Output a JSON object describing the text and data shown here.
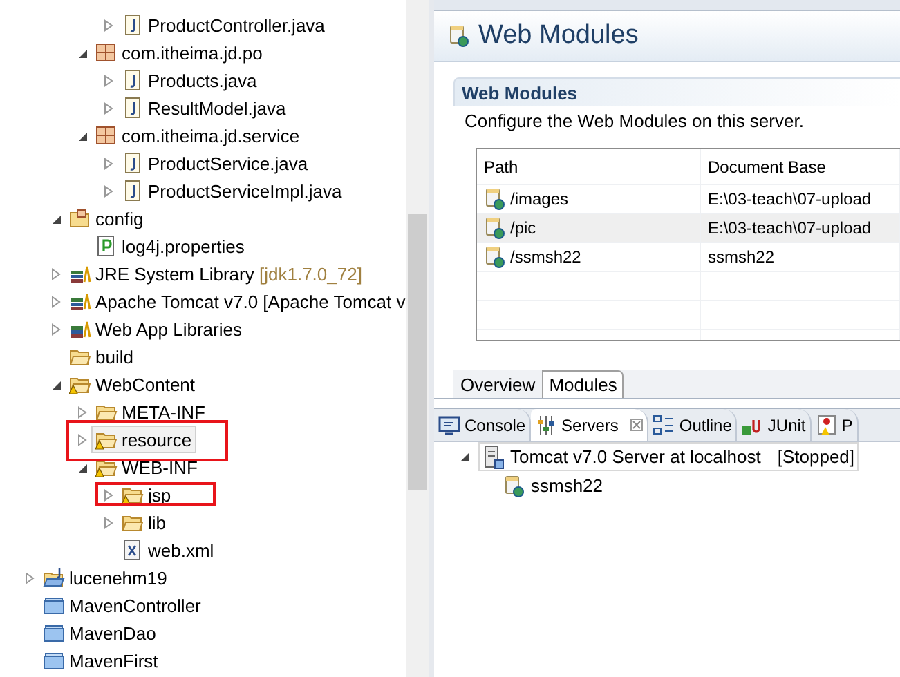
{
  "explorer": {
    "tree": [
      {
        "children": [
          {
            "children": [
              {
                "children": [
                  {
                    "label": "ProductController.java",
                    "kind": "java",
                    "expanded": false
                  }
                ]
              },
              {
                "label": "com.itheima.jd.po",
                "kind": "package",
                "expanded": true,
                "children": [
                  {
                    "label": "Products.java",
                    "kind": "java",
                    "expanded": false
                  },
                  {
                    "label": "ResultModel.java",
                    "kind": "java",
                    "expanded": false
                  }
                ]
              },
              {
                "label": "com.itheima.jd.service",
                "kind": "package",
                "expanded": true,
                "children": [
                  {
                    "label": "ProductService.java",
                    "kind": "java",
                    "expanded": false
                  },
                  {
                    "label": "ProductServiceImpl.java",
                    "kind": "java",
                    "expanded": false
                  }
                ]
              }
            ]
          },
          {
            "label": "config",
            "kind": "source-folder",
            "expanded": true,
            "children": [
              {
                "label": "log4j.properties",
                "kind": "properties"
              }
            ]
          },
          {
            "label": "JRE System Library",
            "decoration": "[jdk1.7.0_72]",
            "kind": "library",
            "expanded": false
          },
          {
            "label": "Apache Tomcat v7.0 [Apache Tomcat v",
            "kind": "library",
            "expanded": false
          },
          {
            "label": "Web App Libraries",
            "kind": "library",
            "expanded": false
          },
          {
            "label": "build",
            "kind": "folder"
          },
          {
            "label": "WebContent",
            "kind": "folder",
            "warning": true,
            "expanded": true,
            "children": [
              {
                "label": "META-INF",
                "kind": "folder",
                "expanded": false
              },
              {
                "label": "resource",
                "kind": "folder",
                "warning": true,
                "expanded": false,
                "selected": true,
                "annotated": true
              },
              {
                "label": "WEB-INF",
                "kind": "folder",
                "warning": true,
                "expanded": true,
                "children": [
                  {
                    "label": "jsp",
                    "kind": "folder",
                    "warning": true,
                    "expanded": false,
                    "annotated": true
                  },
                  {
                    "label": "lib",
                    "kind": "folder",
                    "expanded": false
                  },
                  {
                    "label": "web.xml",
                    "kind": "xml"
                  }
                ]
              }
            ]
          }
        ]
      },
      {
        "label": "lucenehm19",
        "kind": "project",
        "expanded": false
      },
      {
        "label": "MavenController",
        "kind": "closed-project"
      },
      {
        "label": "MavenDao",
        "kind": "closed-project"
      },
      {
        "label": "MavenFirst",
        "kind": "closed-project"
      }
    ]
  },
  "editor": {
    "title": "Web Modules",
    "section": {
      "title": "Web Modules",
      "description": "Configure the Web Modules on this server.",
      "table": {
        "columns": [
          "Path",
          "Document Base"
        ],
        "rows": [
          {
            "path": "/images",
            "document_base": "E:\\03-teach\\07-upload",
            "selected": false
          },
          {
            "path": "/pic",
            "document_base": "E:\\03-teach\\07-upload",
            "selected": true
          },
          {
            "path": "/ssmsh22",
            "document_base": "ssmsh22",
            "selected": false
          }
        ]
      }
    },
    "tabs": [
      {
        "label": "Overview",
        "selected": false
      },
      {
        "label": "Modules",
        "selected": true
      }
    ]
  },
  "bottom_panel": {
    "tabs": [
      {
        "label": "Console",
        "kind": "console",
        "selected": false
      },
      {
        "label": "Servers",
        "kind": "servers",
        "selected": true
      },
      {
        "label": "Outline",
        "kind": "outline",
        "selected": false
      },
      {
        "label": "JUnit",
        "kind": "junit",
        "selected": false
      },
      {
        "label": "P",
        "kind": "problems",
        "selected": false
      }
    ],
    "servers": [
      {
        "name": "Tomcat v7.0 Server at localhost",
        "status": "[Stopped]",
        "expanded": true,
        "modules": [
          "ssmsh22"
        ]
      }
    ]
  }
}
